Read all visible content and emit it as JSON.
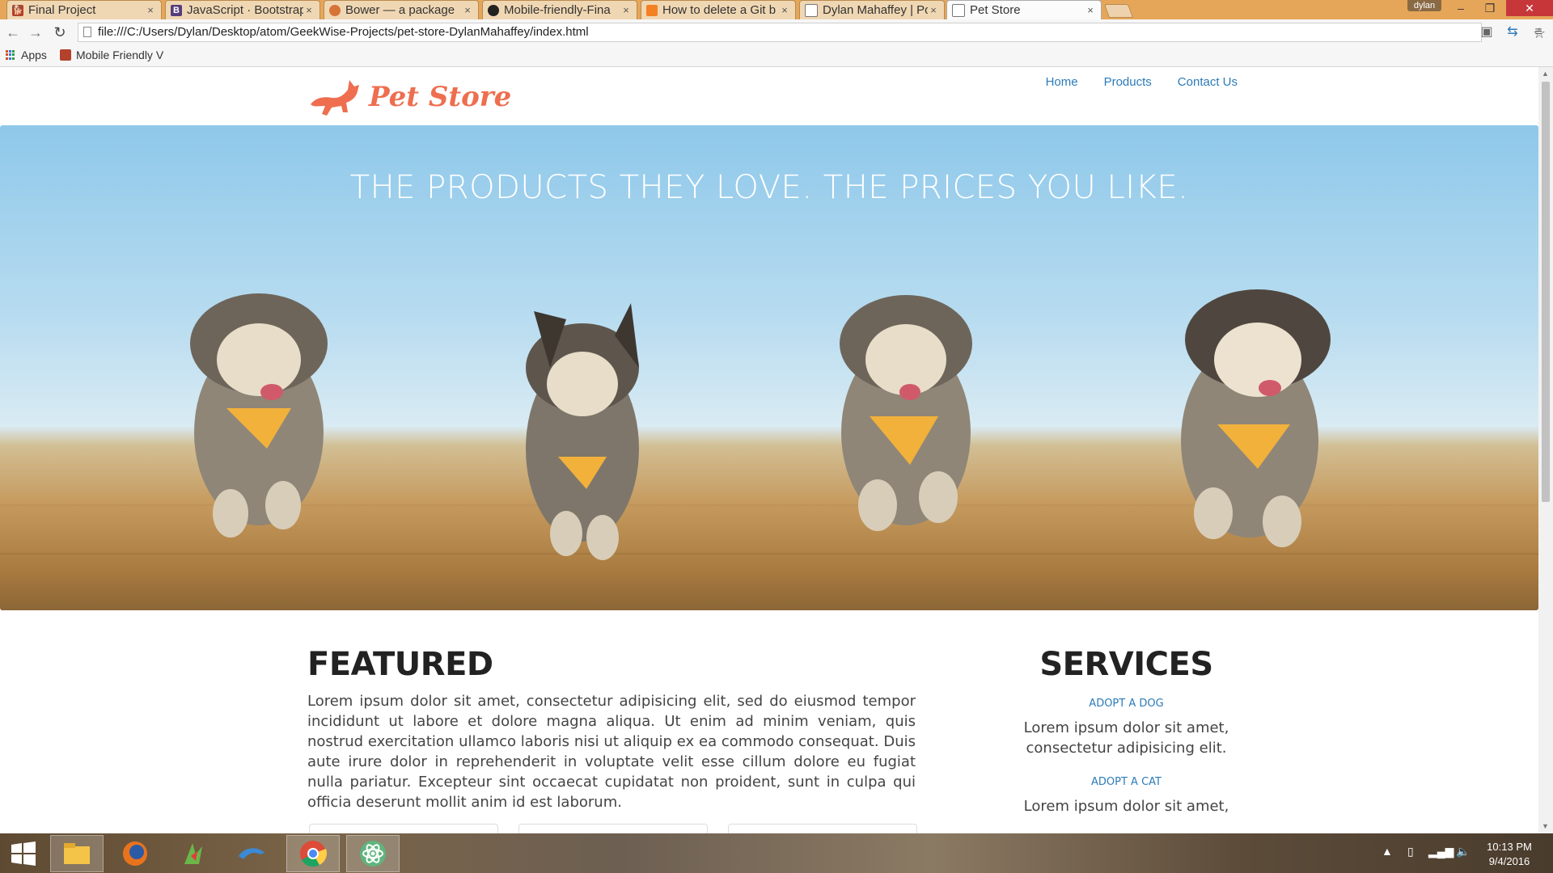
{
  "browser": {
    "tabs": [
      {
        "label": "Final Project",
        "favicon": "dog-icon",
        "color": "#b3412b"
      },
      {
        "label": "JavaScript · Bootstrap",
        "favicon": "bootstrap-icon",
        "color": "#563d7c"
      },
      {
        "label": "Bower — a package",
        "favicon": "bower-icon",
        "color": "#d67438"
      },
      {
        "label": "Mobile-friendly-Fina",
        "favicon": "github-icon",
        "color": "#222222"
      },
      {
        "label": "How to delete a Git b",
        "favicon": "stackoverflow-icon",
        "color": "#f48024"
      },
      {
        "label": "Dylan Mahaffey | Por",
        "favicon": "page-icon",
        "color": "#777777"
      },
      {
        "label": "Pet Store",
        "favicon": "page-icon",
        "color": "#777777"
      }
    ],
    "tab_close": "×",
    "user": "dylan",
    "window_controls": {
      "minimize": "–",
      "maximize": "❐",
      "close": "✕"
    },
    "url": "file:///C:/Users/Dylan/Desktop/atom/GeekWise-Projects/pet-store-DylanMahaffey/index.html",
    "bookmarks": [
      {
        "label": "Apps",
        "icon": "apps-grid-icon"
      },
      {
        "label": "Mobile Friendly V",
        "icon": "dog-icon"
      }
    ]
  },
  "site": {
    "logo_text": "Pet Store",
    "nav": [
      "Home",
      "Products",
      "Contact Us"
    ],
    "hero_tagline": "THE PRODUCTS THEY LOVE. THE PRICES YOU LIKE.",
    "featured": {
      "title": "FEATURED",
      "body": "Lorem ipsum dolor sit amet, consectetur adipisicing elit, sed do eiusmod tempor incididunt ut labore et dolore magna aliqua. Ut enim ad minim veniam, quis nostrud exercitation ullamco laboris nisi ut aliquip ex ea commodo consequat. Duis aute irure dolor in reprehenderit in voluptate velit esse cillum dolore eu fugiat nulla pariatur. Excepteur sint occaecat cupidatat non proident, sunt in culpa qui officia deserunt mollit anim id est laborum."
    },
    "services": {
      "title": "SERVICES",
      "items": [
        {
          "link": "ADOPT A DOG",
          "text": "Lorem ipsum dolor sit amet, consectetur adipisicing elit."
        },
        {
          "link": "ADOPT A CAT",
          "text": "Lorem ipsum dolor sit amet,"
        }
      ]
    },
    "accent_color": "#ee6e4f",
    "link_color": "#2c7bb8"
  },
  "taskbar": {
    "items": [
      "windows-start-icon",
      "file-explorer-icon",
      "firefox-icon",
      "app-icon",
      "dolphin-icon",
      "chrome-icon",
      "atom-icon"
    ],
    "time": "10:13 PM",
    "date": "9/4/2016"
  }
}
